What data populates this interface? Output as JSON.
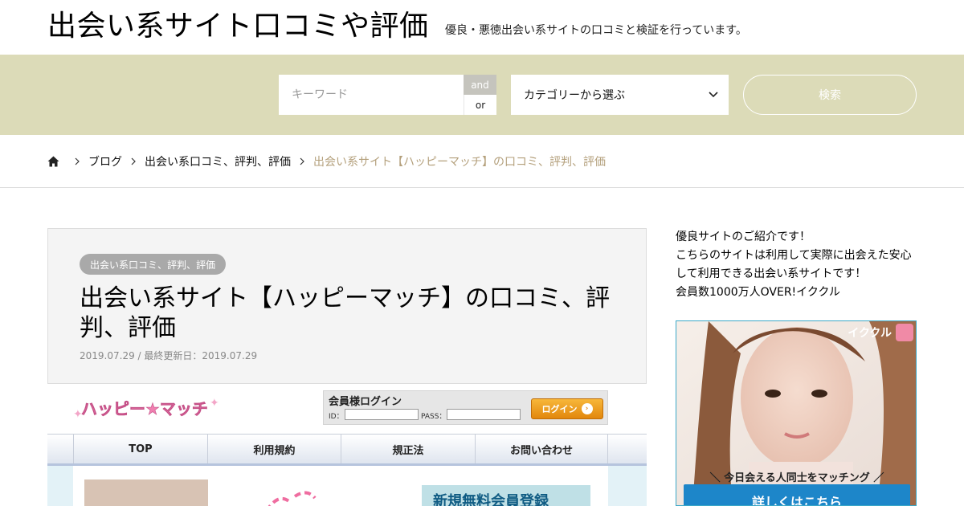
{
  "header": {
    "site_title": "出会い系サイト口コミや評価",
    "site_description": "優良・悪徳出会い系サイトの口コミと検証を行っています。"
  },
  "search": {
    "keyword_placeholder": "キーワード",
    "and_label": "and",
    "or_label": "or",
    "category_placeholder": "カテゴリーから選ぶ",
    "search_button": "検索"
  },
  "breadcrumb": {
    "items": [
      "ブログ",
      "出会い系口コミ、評判、評価"
    ],
    "current": "出会い系サイト【ハッピーマッチ】の口コミ、評判、評価"
  },
  "article": {
    "category": "出会い系口コミ、評判、評価",
    "title": "出会い系サイト【ハッピーマッチ】の口コミ、評判、評価",
    "date": "2019.07.29 / 最終更新日：2019.07.29"
  },
  "featured_image": {
    "logo_text": "ハッピー★マッチ",
    "login_title": "会員様ログイン",
    "id_label": "ID：",
    "pass_label": "PASS：",
    "login_button": "ログイン",
    "nav": [
      "TOP",
      "利用規約",
      "規正法",
      "お問い合わせ"
    ],
    "banner_text": "新規無料会員登録"
  },
  "sidebar": {
    "lines": [
      "優良サイトのご紹介です！",
      "こちらのサイトは利用して実際に出会えた安心",
      "して利用できる出会い系サイトです！",
      "会員数1000万人OVER!イククル"
    ],
    "ad": {
      "brand": "イククル",
      "tagline": "＼ 今日会える人同士をマッチング ／",
      "cta": "詳しくはこちら"
    }
  },
  "colors": {
    "search_band": "#dcdbb8",
    "breadcrumb_current": "#b4a07c",
    "category_badge": "#a9a9a9",
    "ad_cta": "#1d86c9"
  }
}
